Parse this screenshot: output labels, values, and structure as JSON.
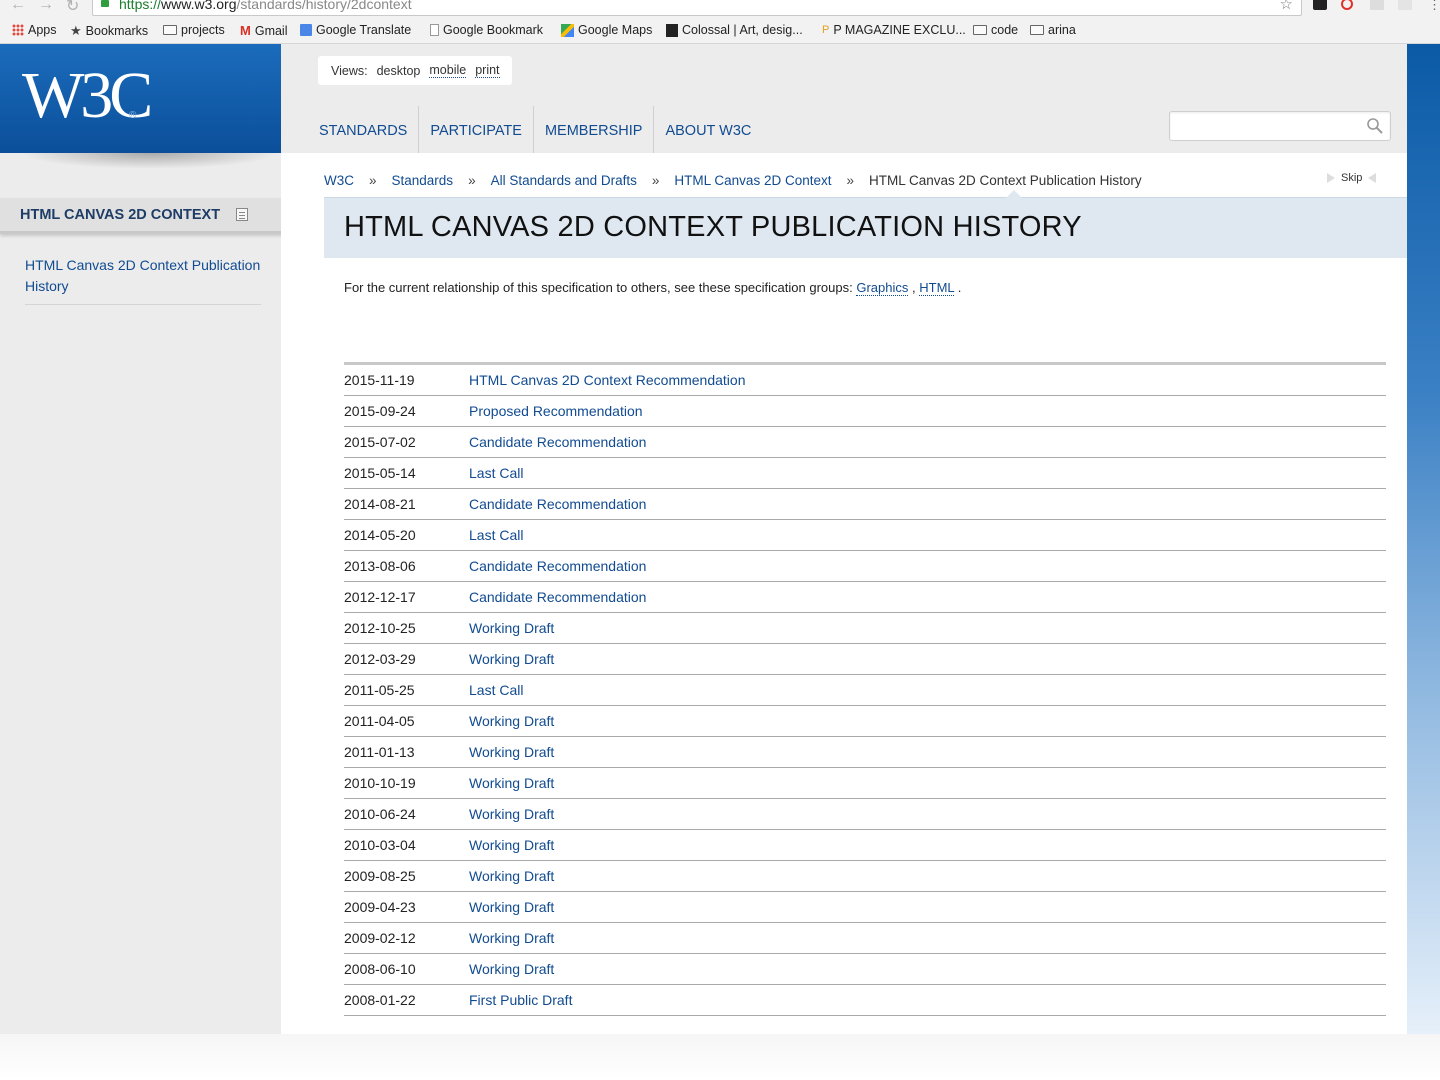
{
  "browser": {
    "url_scheme": "https://",
    "url_host": "www.w3.org",
    "url_path": "/standards/history/2dcontext",
    "bookmarks": [
      {
        "label": "Apps",
        "icon": "apps-grid-icon"
      },
      {
        "label": "Bookmarks",
        "icon": "star-icon"
      },
      {
        "label": "projects",
        "icon": "folder-icon"
      },
      {
        "label": "Gmail",
        "icon": "gmail-icon"
      },
      {
        "label": "Google Translate",
        "icon": "translate-icon"
      },
      {
        "label": "Google Bookmark",
        "icon": "page-icon"
      },
      {
        "label": "Google Maps",
        "icon": "maps-icon"
      },
      {
        "label": "Colossal | Art, desig...",
        "icon": "film-icon"
      },
      {
        "label": "P MAGAZINE EXCLU...",
        "icon": "p-icon"
      },
      {
        "label": "code",
        "icon": "folder-icon"
      },
      {
        "label": "arina",
        "icon": "folder-icon"
      }
    ]
  },
  "header": {
    "logo_text": "W3C",
    "logo_reg": "®",
    "views_label": "Views:",
    "views": [
      "desktop",
      "mobile",
      "print"
    ],
    "nav": [
      "STANDARDS",
      "PARTICIPATE",
      "MEMBERSHIP",
      "ABOUT W3C"
    ],
    "search_placeholder": ""
  },
  "sidebar": {
    "title": "HTML CANVAS 2D CONTEXT",
    "link": "HTML Canvas 2D Context Publication History"
  },
  "breadcrumb": {
    "items": [
      "W3C",
      "Standards",
      "All Standards and Drafts",
      "HTML Canvas 2D Context"
    ],
    "separator": "»",
    "current": "HTML Canvas 2D Context Publication History",
    "skip": "Skip"
  },
  "main": {
    "title": "HTML CANVAS 2D CONTEXT PUBLICATION HISTORY",
    "intro_text": "For the current relationship of this specification to others, see these specification groups:",
    "intro_links": [
      "Graphics",
      "HTML"
    ],
    "intro_comma": ",",
    "intro_period": ".",
    "history": [
      {
        "date": "2015-11-19",
        "status": "HTML Canvas 2D Context Recommendation"
      },
      {
        "date": "2015-09-24",
        "status": "Proposed Recommendation"
      },
      {
        "date": "2015-07-02",
        "status": "Candidate Recommendation"
      },
      {
        "date": "2015-05-14",
        "status": "Last Call"
      },
      {
        "date": "2014-08-21",
        "status": "Candidate Recommendation"
      },
      {
        "date": "2014-05-20",
        "status": "Last Call"
      },
      {
        "date": "2013-08-06",
        "status": "Candidate Recommendation"
      },
      {
        "date": "2012-12-17",
        "status": "Candidate Recommendation"
      },
      {
        "date": "2012-10-25",
        "status": "Working Draft"
      },
      {
        "date": "2012-03-29",
        "status": "Working Draft"
      },
      {
        "date": "2011-05-25",
        "status": "Last Call"
      },
      {
        "date": "2011-04-05",
        "status": "Working Draft"
      },
      {
        "date": "2011-01-13",
        "status": "Working Draft"
      },
      {
        "date": "2010-10-19",
        "status": "Working Draft"
      },
      {
        "date": "2010-06-24",
        "status": "Working Draft"
      },
      {
        "date": "2010-03-04",
        "status": "Working Draft"
      },
      {
        "date": "2009-08-25",
        "status": "Working Draft"
      },
      {
        "date": "2009-04-23",
        "status": "Working Draft"
      },
      {
        "date": "2009-02-12",
        "status": "Working Draft"
      },
      {
        "date": "2008-06-10",
        "status": "Working Draft"
      },
      {
        "date": "2008-01-22",
        "status": "First Public Draft"
      }
    ]
  },
  "colors": {
    "brand_blue": "#0b4f9a",
    "link": "#114b91",
    "title_band": "#dfe8f1"
  }
}
